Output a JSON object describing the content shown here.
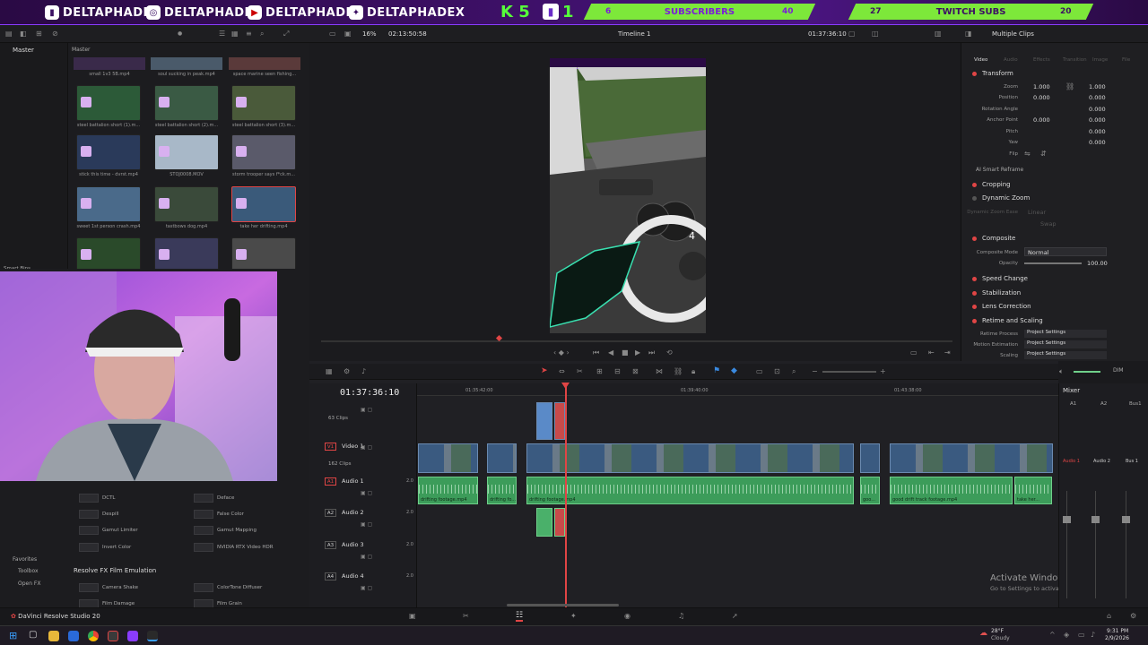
{
  "banner": {
    "socials": [
      {
        "icon": "twitch-icon",
        "handle": "DELTAPHADE"
      },
      {
        "icon": "instagram-icon",
        "handle": "DELTAPHADE"
      },
      {
        "icon": "youtube-icon",
        "handle": "DELTAPHADE"
      },
      {
        "icon": "twitter-icon",
        "handle": "DELTAPHADEX"
      }
    ],
    "kick_count": "5",
    "twitch_count": "1",
    "subs_left": "6",
    "subs_label": "SUBSCRIBERS",
    "subs_goal": "40",
    "twitch_left": "27",
    "twitch_label": "TWITCH SUBS",
    "twitch_goal": "20"
  },
  "toolbar": {
    "zoom": "16%",
    "source_tc": "02:13:50:58",
    "timeline_name": "Timeline 1",
    "record_tc": "01:37:36:10",
    "inspector_title": "Multiple Clips"
  },
  "mediapool": {
    "left_label": "Master",
    "bin_label": "Master",
    "smart_bins": "Smart Bins",
    "top_captions": [
      "small 1v3 5B.mp4",
      "soul sucking in peak.mp4",
      "space marine seen fishing..."
    ],
    "clips": [
      {
        "name": "steel battalion short (1).m..."
      },
      {
        "name": "steel battalion short (2).m..."
      },
      {
        "name": "steel battalion short (3).m..."
      },
      {
        "name": "stick this time - dvrst.mp4"
      },
      {
        "name": "STOJ0008.MOV"
      },
      {
        "name": "storm trooper says f*ck.m..."
      },
      {
        "name": "sweet 1st person crash.mp4"
      },
      {
        "name": "tastbows dog.mp4"
      },
      {
        "name": "take her drifting.mp4"
      },
      {
        "name": ""
      },
      {
        "name": ""
      },
      {
        "name": ""
      }
    ]
  },
  "inspector": {
    "tabs": [
      "Video",
      "Audio",
      "Effects",
      "Transition",
      "Image",
      "File"
    ],
    "transform": "Transform",
    "zoom_label": "Zoom",
    "zoom_x": "1.000",
    "zoom_y": "1.000",
    "position_label": "Position",
    "pos_x": "0.000",
    "pos_y": "0.000",
    "rotation_label": "Rotation Angle",
    "rotation": "0.000",
    "anchor_label": "Anchor Point",
    "anchor_x": "0.000",
    "anchor_y": "0.000",
    "pitch_label": "Pitch",
    "pitch": "0.000",
    "yaw_label": "Yaw",
    "yaw": "0.000",
    "flip_label": "Flip",
    "smart_reframe": "AI Smart Reframe",
    "cropping": "Cropping",
    "dynamic_zoom": "Dynamic Zoom",
    "dz_ease_label": "Dynamic Zoom Ease",
    "dz_ease": "Linear",
    "swap": "Swap",
    "composite": "Composite",
    "comp_mode_label": "Composite Mode",
    "comp_mode": "Normal",
    "opacity_label": "Opacity",
    "opacity": "100.00",
    "speed_change": "Speed Change",
    "stabilization": "Stabilization",
    "lens_correction": "Lens Correction",
    "retime_scaling": "Retime and Scaling",
    "retime_process_label": "Retime Process",
    "retime_process": "Project Settings",
    "motion_est_label": "Motion Estimation",
    "motion_est": "Project Settings",
    "scaling_label": "Scaling",
    "scaling": "Project Settings"
  },
  "timeline": {
    "timecode": "01:37:36:10",
    "ruler": [
      "01:35:42:00",
      "01:39:40:00",
      "01:43:38:00"
    ],
    "tracks": [
      {
        "id": "",
        "name": "",
        "sub": "63 Clips"
      },
      {
        "id": "V1",
        "name": "Video 1",
        "sub": "162 Clips"
      },
      {
        "id": "A1",
        "name": "Audio 1",
        "level": "2.0"
      },
      {
        "id": "A2",
        "name": "Audio 2",
        "level": "2.0"
      },
      {
        "id": "A3",
        "name": "Audio 3",
        "level": "2.0"
      },
      {
        "id": "A4",
        "name": "Audio 4",
        "level": "2.0"
      }
    ],
    "audio_clip_names": [
      "drifting footage.mp4",
      "drifting fo...",
      "drifting footage.mp4",
      "goo...",
      "good drift track footage.mp4",
      "take her..."
    ]
  },
  "mixer": {
    "title": "Mixer",
    "cols": [
      "A1",
      "A2",
      "Bus1"
    ],
    "labels": [
      "Audio 1",
      "Audio 2",
      "Bus 1"
    ],
    "dim": "DIM"
  },
  "effects": {
    "items": [
      "DCTL",
      "Deface",
      "Despill",
      "False Color",
      "Gamut Limiter",
      "Gamut Mapping",
      "Invert Color",
      "NVIDIA RTX Video HDR"
    ],
    "section": "Resolve FX Film Emulation",
    "film_items": [
      "Camera Shake",
      "ColorTone Diffuser",
      "Film Damage",
      "Film Grain"
    ],
    "sidebar": [
      "Favorites",
      "Toolbox",
      "Open FX"
    ]
  },
  "footer": {
    "app_name": "DaVinci Resolve Studio 20",
    "activate_title": "Activate Windows",
    "activate_sub": "Go to Settings to activate Windows.",
    "weather_temp": "28°F",
    "weather_desc": "Cloudy",
    "time": "9:31 PM",
    "date": "2/9/2026"
  },
  "colors": {
    "accent": "#e04545",
    "banner_purple": "#3b0f63",
    "green": "#56ff3a"
  }
}
